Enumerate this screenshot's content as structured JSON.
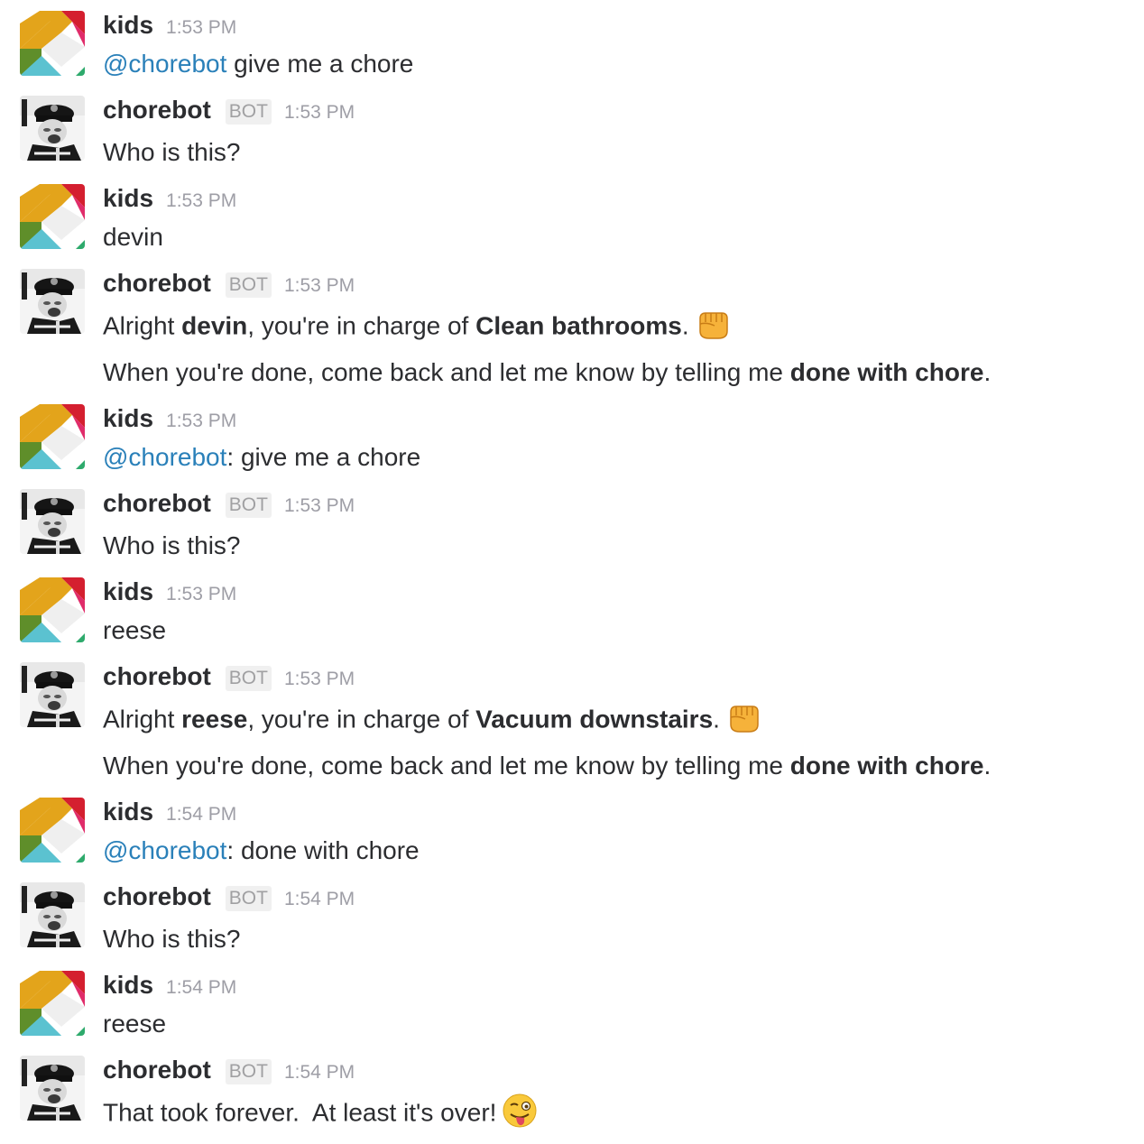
{
  "icons": {
    "kids_avatar": "kids-avatar-icon",
    "bot_avatar": "chorebot-avatar-icon",
    "fist_emoji": "fisted-hand-emoji-icon",
    "wink_emoji": "winking-tongue-emoji-icon"
  },
  "colors": {
    "mention": "#2a80b9",
    "text": "#2c2d30",
    "timestamp": "#9e9ea6",
    "bot_badge_bg": "#f0f0f0",
    "bot_badge_text": "#a0a0a2"
  },
  "messages": [
    {
      "sender": "kids",
      "time": "1:53 PM",
      "lines": [
        "@chorebot give me a chore"
      ]
    },
    {
      "sender": "chorebot",
      "badge": "BOT",
      "time": "1:53 PM",
      "lines": [
        "Who is this?"
      ]
    },
    {
      "sender": "kids",
      "time": "1:53 PM",
      "lines": [
        "devin"
      ]
    },
    {
      "sender": "chorebot",
      "badge": "BOT",
      "time": "1:53 PM",
      "line1": {
        "a": "Alright ",
        "name": "devin",
        "b": ", you're in charge of ",
        "chore": "Clean bathrooms",
        "c": "."
      },
      "line2": {
        "a": "When you're done, come back and let me know by telling me ",
        "cmd": "done with chore",
        "b": "."
      }
    },
    {
      "sender": "kids",
      "time": "1:53 PM",
      "mention": "@chorebot",
      "text": ": give me a chore"
    },
    {
      "sender": "chorebot",
      "badge": "BOT",
      "time": "1:53 PM",
      "lines": [
        "Who is this?"
      ]
    },
    {
      "sender": "kids",
      "time": "1:53 PM",
      "lines": [
        "reese"
      ]
    },
    {
      "sender": "chorebot",
      "badge": "BOT",
      "time": "1:53 PM",
      "line1": {
        "a": "Alright ",
        "name": "reese",
        "b": ", you're in charge of ",
        "chore": "Vacuum downstairs",
        "c": "."
      },
      "line2": {
        "a": "When you're done, come back and let me know by telling me ",
        "cmd": "done with chore",
        "b": "."
      }
    },
    {
      "sender": "kids",
      "time": "1:54 PM",
      "mention": "@chorebot",
      "text": ": done with chore"
    },
    {
      "sender": "chorebot",
      "badge": "BOT",
      "time": "1:54 PM",
      "lines": [
        "Who is this?"
      ]
    },
    {
      "sender": "kids",
      "time": "1:54 PM",
      "lines": [
        "reese"
      ]
    },
    {
      "sender": "chorebot",
      "badge": "BOT",
      "time": "1:54 PM",
      "lines": [
        "That took forever.  At least it's over!"
      ]
    }
  ]
}
